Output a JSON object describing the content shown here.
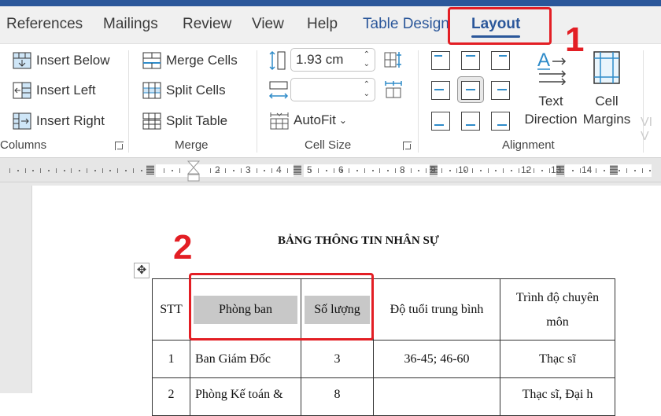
{
  "ribbon_tabs": [
    {
      "label": "References"
    },
    {
      "label": "Mailings"
    },
    {
      "label": "Review"
    },
    {
      "label": "View"
    },
    {
      "label": "Help"
    },
    {
      "label": "Table Design"
    },
    {
      "label": "Layout",
      "active": true
    }
  ],
  "groups": {
    "rows_columns": {
      "label": "Columns",
      "buttons": [
        "Insert Below",
        "Insert Left",
        "Insert Right"
      ]
    },
    "merge": {
      "label": "Merge",
      "buttons": [
        "Merge Cells",
        "Split Cells",
        "Split Table"
      ]
    },
    "cell_size": {
      "label": "Cell Size",
      "height_value": "1.93 cm",
      "width_value": "",
      "autofit_label": "AutoFit"
    },
    "alignment": {
      "label": "Alignment",
      "text_direction_label": [
        "Text",
        "Direction"
      ],
      "cell_margins_label": [
        "Cell",
        "Margins"
      ],
      "selected_alignment": "center-left-middle"
    },
    "overflow_text": "VI V"
  },
  "ruler": {
    "numbers": [
      "2",
      "3",
      "4",
      "5",
      "6",
      "8",
      "9",
      "10",
      "12",
      "13",
      "14"
    ]
  },
  "document": {
    "title": "BẢNG THÔNG TIN NHÂN SỰ",
    "table": {
      "headers": [
        "STT",
        "Phòng ban",
        "Số lượng",
        "Độ tuổi trung bình",
        "Trình độ chuyên môn"
      ],
      "rows": [
        [
          "1",
          "Ban Giám Đốc",
          "3",
          "36-45; 46-60",
          "Thạc sĩ"
        ],
        [
          "2",
          "Phòng Kế toán &",
          "8",
          "",
          "Thạc sĩ, Đại h"
        ]
      ]
    }
  },
  "annotations": {
    "step1": "1",
    "step2": "2",
    "accent_color": "#e31e24"
  }
}
